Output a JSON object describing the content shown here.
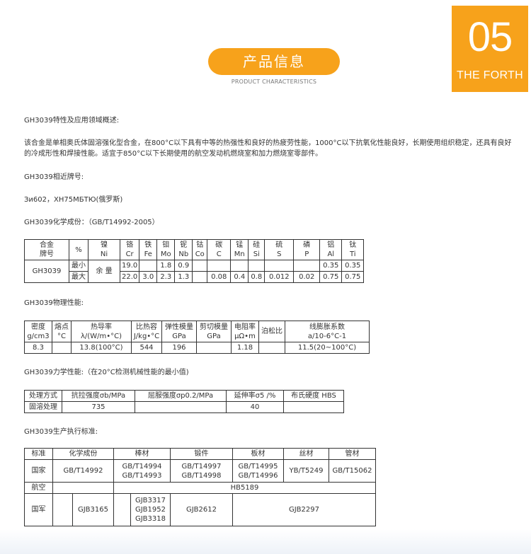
{
  "badge": {
    "number": "05",
    "subtitle": "THE FORTH"
  },
  "header": {
    "title": "产品信息",
    "subtitle": "PRODUCT CHARACTERISTICS"
  },
  "sections": {
    "overview_title": "GH3039特性及应用领域概述:",
    "overview_text": "该合金是单相奥氏体固溶强化型合金，在800°C以下具有中等的热强性和良好的热疲劳性能，1000°C以下抗氧化性能良好，长期使用组织稳定，还具有良好的冷成形性和焊接性能。适宜于850°C以下长期使用的航空发动机燃烧室和加力燃烧室零部件。",
    "similar_title": "GH3039相近牌号:",
    "similar_text": "Зи602，ХН75МБТЮ(俄罗斯)",
    "chem_title": "GH3039化学成份：（GB/T14992-2005）",
    "phys_title": "GH3039物理性能:",
    "mech_title": "GH3039力学性能:（在20°C检测机械性能的最小值)",
    "std_title": "GH3039生产执行标准:"
  },
  "chem": {
    "h1": "合金",
    "h1b": "牌号",
    "pct": "%",
    "elements": [
      [
        "镍",
        "Ni"
      ],
      [
        "铬",
        "Cr"
      ],
      [
        "铁",
        "Fe"
      ],
      [
        "钼",
        "Mo"
      ],
      [
        "铌",
        "Nb"
      ],
      [
        "钴",
        "Co"
      ],
      [
        "碳",
        "C"
      ],
      [
        "锰",
        "Mn"
      ],
      [
        "硅",
        "Si"
      ],
      [
        "硫",
        "S"
      ],
      [
        "磷",
        "P"
      ],
      [
        "铝",
        "Al"
      ],
      [
        "钛",
        "Ti"
      ]
    ],
    "grade": "GH3039",
    "min": "最小",
    "max": "最大",
    "balance": "余 量",
    "min_vals": [
      "19.0",
      "",
      "1.8",
      "0.9",
      "",
      "",
      "",
      "",
      "",
      "",
      "0.35",
      "0.35"
    ],
    "max_vals": [
      "22.0",
      "3.0",
      "2.3",
      "1.3",
      "",
      "0.08",
      "0.4",
      "0.8",
      "0.012",
      "0.02",
      "0.75",
      "0.75"
    ]
  },
  "phys": {
    "headers": [
      [
        "密度",
        "g/cm3"
      ],
      [
        "熔点",
        "°C"
      ],
      [
        "热导率",
        "λ/(W/m•°C)"
      ],
      [
        "比热容",
        "J/kg•°C"
      ],
      [
        "弹性模量",
        "GPa"
      ],
      [
        "剪切模量",
        "GPa"
      ],
      [
        "电阻率",
        "μΩ•m"
      ],
      [
        "泊松比",
        ""
      ],
      [
        "线膨胀系数",
        "a/10-6°C-1"
      ]
    ],
    "values": [
      "8.3",
      "",
      "13.8(100°C)",
      "544",
      "196",
      "",
      "1.18",
      "",
      "11.5(20~100°C)"
    ]
  },
  "mech": {
    "headers": [
      "处理方式",
      "抗拉强度σb/MPa",
      "屈服强度σp0.2/MPa",
      "延伸率σ5 /%",
      "布氏硬度 HBS"
    ],
    "values": [
      "固溶处理",
      "735",
      "",
      "40",
      ""
    ]
  },
  "std": {
    "headers": [
      "标准",
      "化学成份",
      "棒材",
      "锻件",
      "板材",
      "丝材",
      "管材"
    ],
    "row1": {
      "label": "国家",
      "chem": "GB/T14992",
      "bar1": "GB/T14994",
      "bar2": "GB/T14993",
      "forg1": "GB/T14997",
      "forg2": "GB/T14998",
      "plate1": "GB/T14995",
      "plate2": "GB/T14996",
      "wire": "YB/T5249",
      "tube": "GB/T15062"
    },
    "row2": {
      "label": "航空",
      "value": "HB5189"
    },
    "row3": {
      "label": "国军",
      "chem": "GJB3165",
      "bar1": "GJB3317",
      "bar2": "GJB1952",
      "bar3": "GJB3318",
      "forg": "GJB2612",
      "plate": "GJB2297"
    }
  }
}
